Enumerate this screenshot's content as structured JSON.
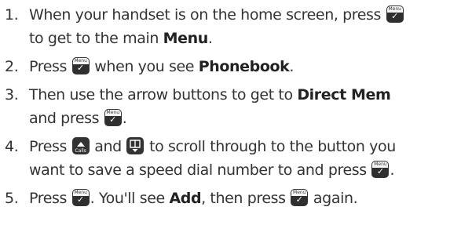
{
  "steps": [
    {
      "number": "1.",
      "line1_text_before_key": "When your handset is on the home screen, press",
      "line2_text_before_bold": "to get to the main",
      "bold": "Menu",
      "text_after_bold": "."
    },
    {
      "number": "2.",
      "text_before_key": "Press",
      "text_after_key": "when you see",
      "bold": "Phonebook",
      "text_after_bold": "."
    },
    {
      "number": "3.",
      "line1_text_before_bold": "Then use the arrow buttons to get to",
      "bold": "Direct Mem",
      "line2_text_before_key": "and press",
      "line2_text_after_key": "."
    },
    {
      "number": "4.",
      "text_before_key_up": "Press",
      "text_between_keys": "and",
      "line1_text_after_keys": "to scroll through to the button you",
      "line2_text_before_key": "want to save a speed dial number to and press",
      "line2_text_after_key": "."
    },
    {
      "number": "5.",
      "text_before_key": "Press",
      "text_after_key": ". You'll see",
      "bold": "Add",
      "text_after_bold": ", then press",
      "text_after_key2": "again."
    }
  ],
  "keys": {
    "menu_key_label": "Menu",
    "menu_key_glyph": "✓",
    "up_key_label": "Calls",
    "up_key_icon": "up-arrow-icon",
    "down_key_icon": "phonebook-down-icon",
    "key_color": "#333333"
  }
}
